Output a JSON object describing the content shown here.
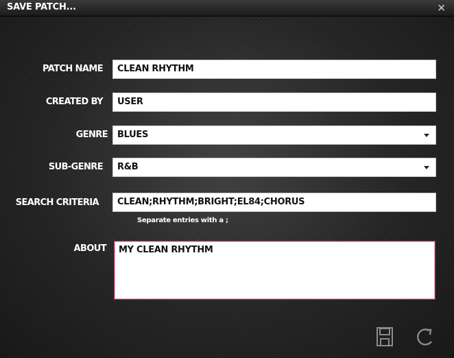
{
  "window": {
    "title": "SAVE PATCH...",
    "close_glyph": "×"
  },
  "form": {
    "patch_name": {
      "label": "PATCH NAME",
      "value": "CLEAN RHYTHM"
    },
    "created_by": {
      "label": "CREATED BY",
      "value": "USER"
    },
    "genre": {
      "label": "GENRE",
      "value": "BLUES"
    },
    "sub_genre": {
      "label": "SUB-GENRE",
      "value": "R&B"
    },
    "search_criteria": {
      "label": "SEARCH CRITERIA",
      "value": "CLEAN;RHYTHM;BRIGHT;EL84;CHORUS",
      "hint": "Separate entries with a ;"
    },
    "about": {
      "label": "ABOUT",
      "value": "MY CLEAN RHYTHM"
    }
  },
  "actions": {
    "save_icon": "floppy-disk-icon",
    "reset_icon": "refresh-icon"
  },
  "colors": {
    "focus_border": "#a8324f",
    "label": "#ffffff",
    "field_bg": "#ffffff"
  }
}
